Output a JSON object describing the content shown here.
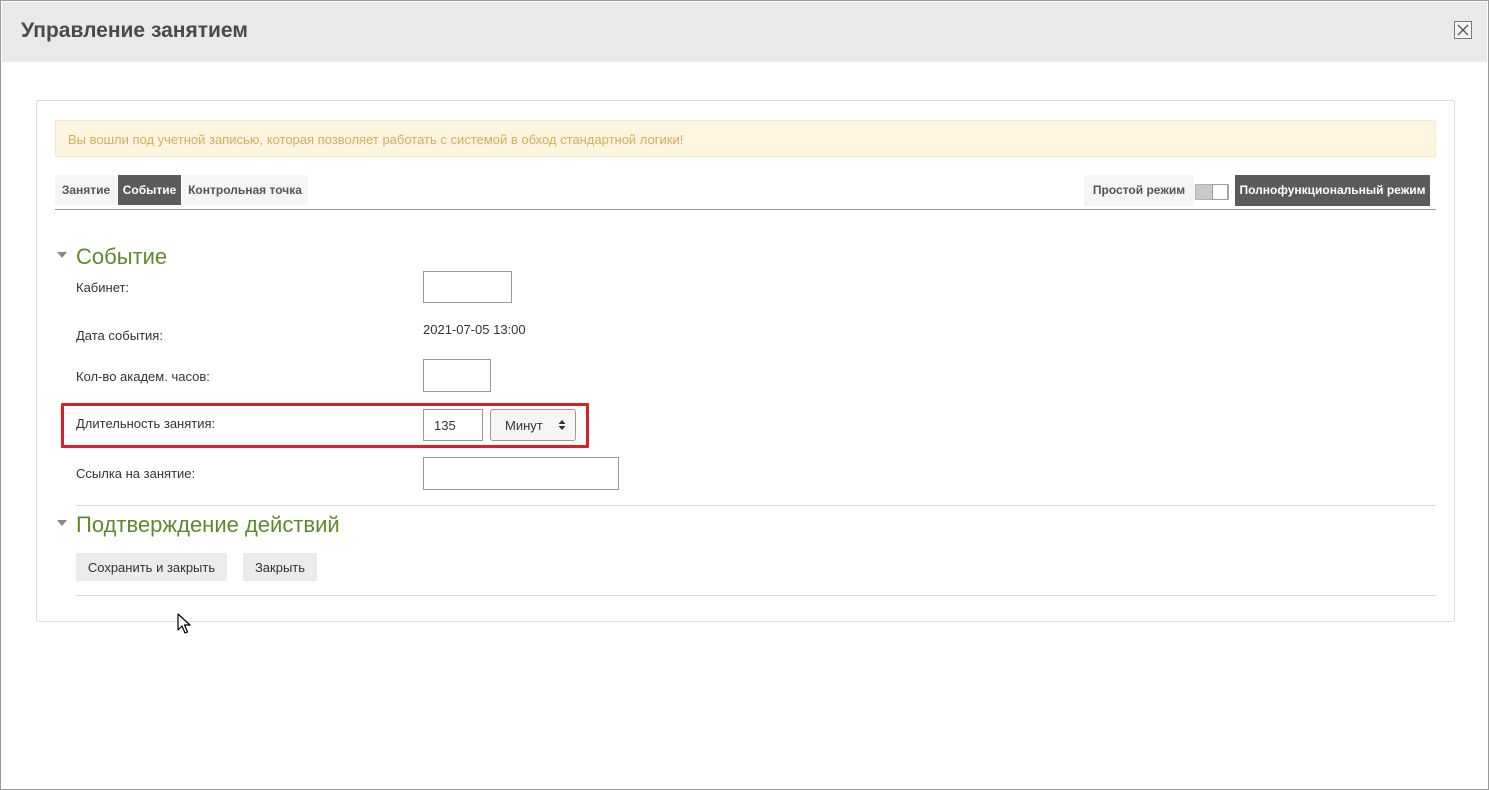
{
  "modal": {
    "title": "Управление занятием",
    "close_icon": "close-icon"
  },
  "alert": {
    "text": "Вы вошли под учетной записью, которая позволяет работать с системой в обход стандартной логики!",
    "color": "#d7ac5c",
    "background": "#fdf5e0"
  },
  "tabs": [
    {
      "label": "Занятие",
      "active": false
    },
    {
      "label": "Событие",
      "active": true
    },
    {
      "label": "Контрольная точка",
      "active": false
    }
  ],
  "mode": {
    "simple_label": "Простой режим",
    "full_label": "Полнофункциональный режим",
    "full_enabled": true
  },
  "event_section": {
    "title": "Событие",
    "caret_icon": "caret-down-icon",
    "fields": {
      "room": {
        "label": "Кабинет:",
        "value": ""
      },
      "date": {
        "label": "Дата события:",
        "value": "2021-07-05 13:00"
      },
      "hours": {
        "label": "Кол-во академ. часов:",
        "value": ""
      },
      "duration": {
        "label": "Длительность занятия:",
        "value": "135",
        "unit": "Минут",
        "unit_icon": "select-arrows-icon"
      },
      "link": {
        "label": "Ссылка на занятие:",
        "value": ""
      }
    }
  },
  "confirm_section": {
    "title": "Подтверждение действий",
    "caret_icon": "caret-down-icon",
    "save_label": "Сохранить и закрыть",
    "close_label": "Закрыть"
  },
  "colors": {
    "accent_green": "#5f8a2a",
    "active_tab": "#5b5b5b",
    "highlight_red": "#d9202a"
  }
}
